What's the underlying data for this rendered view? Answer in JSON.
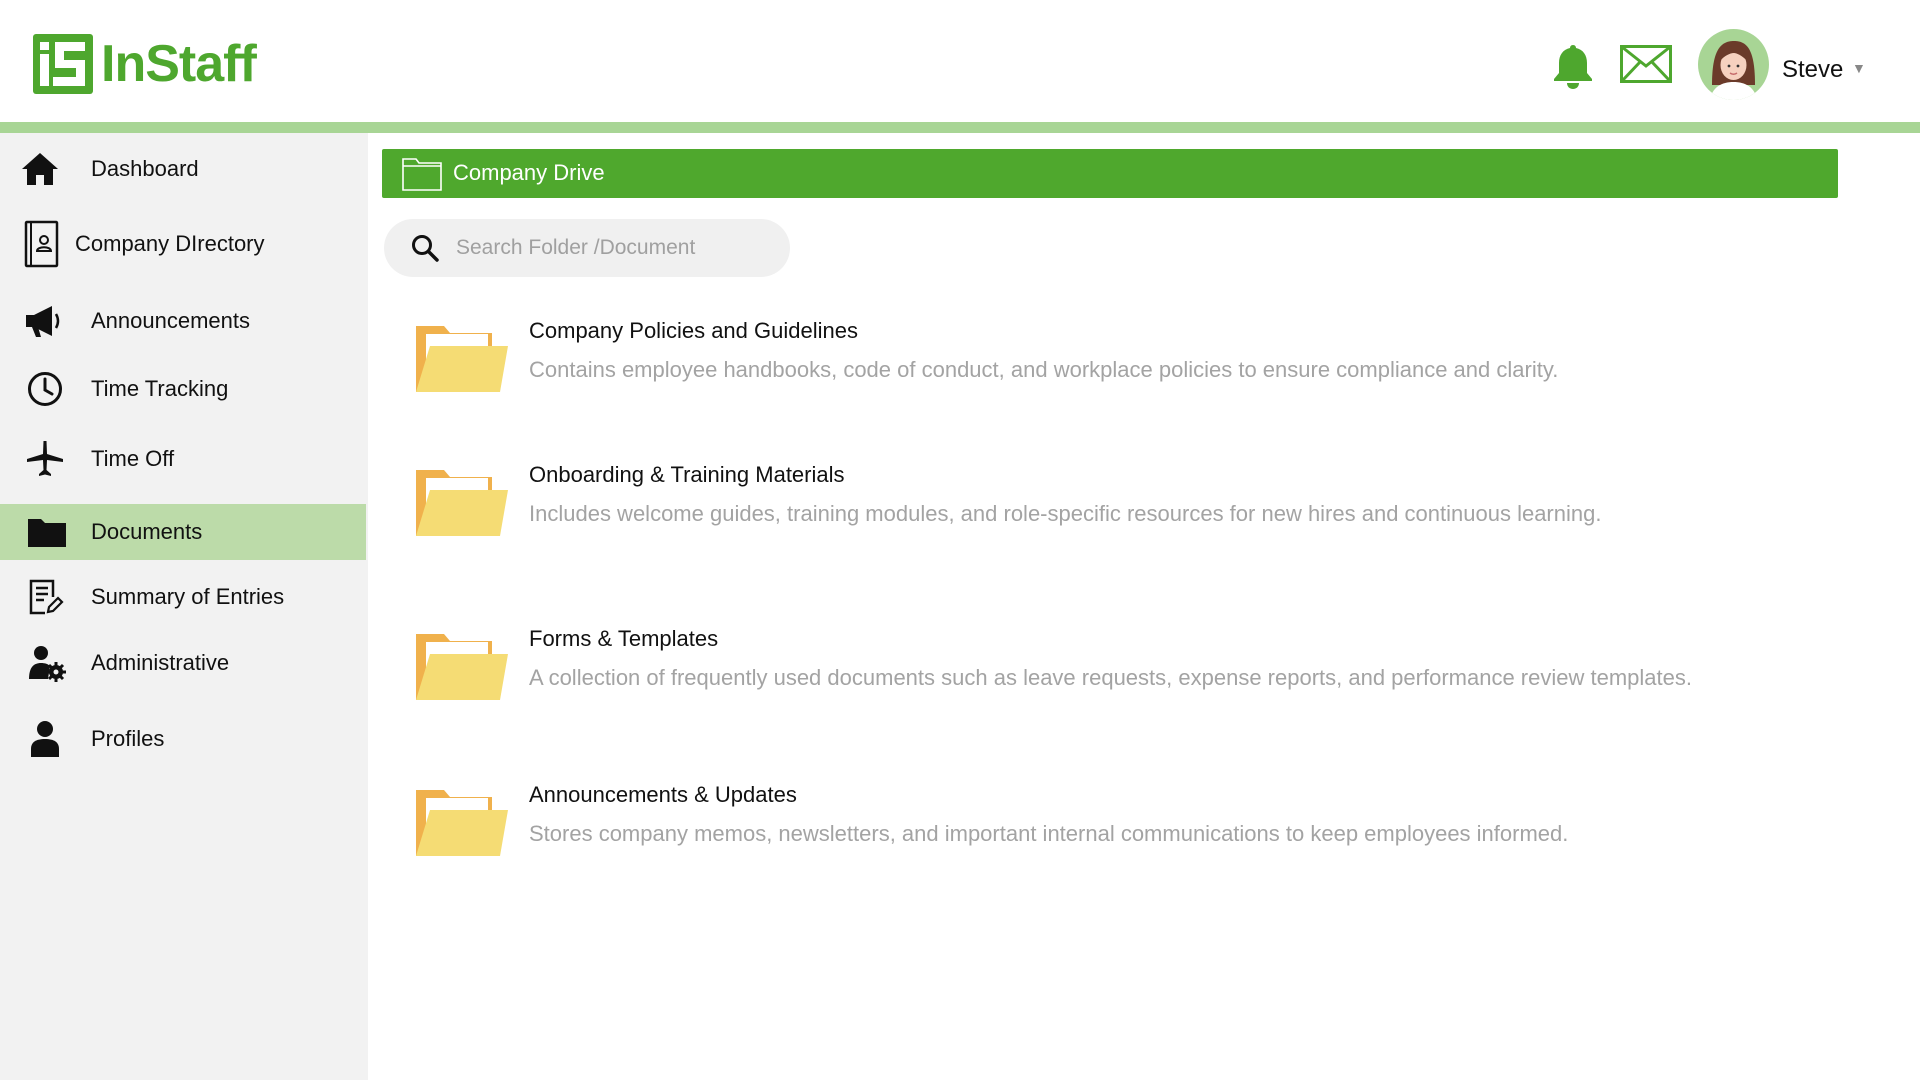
{
  "brand": {
    "name": "InStaff",
    "color": "#4ea72e"
  },
  "header": {
    "icons": [
      "bell-icon",
      "mail-icon"
    ],
    "user": {
      "name": "Steve",
      "caret": "▼"
    }
  },
  "sidebar": {
    "active_color": "#bcdba9",
    "items": [
      {
        "label": "Dashboard",
        "icon": "home-icon"
      },
      {
        "label": "Company DIrectory",
        "icon": "contact-book-icon"
      },
      {
        "label": "Announcements",
        "icon": "megaphone-icon"
      },
      {
        "label": "Time Tracking",
        "icon": "clock-icon"
      },
      {
        "label": "Time Off",
        "icon": "airplane-icon"
      },
      {
        "label": "Documents",
        "icon": "folder-icon",
        "active": true
      },
      {
        "label": "Summary of Entries",
        "icon": "edit-document-icon"
      },
      {
        "label": "Administrative",
        "icon": "user-gear-icon"
      },
      {
        "label": "Profiles",
        "icon": "user-icon"
      }
    ]
  },
  "drive": {
    "title": "Company Drive",
    "color": "#4fa82d"
  },
  "search": {
    "placeholder": "Search Folder /Document",
    "value": ""
  },
  "folders": [
    {
      "title": "Company Policies and Guidelines",
      "description": "Contains employee handbooks, code of conduct, and workplace policies to ensure compliance and clarity."
    },
    {
      "title": "Onboarding & Training Materials",
      "description": "Includes welcome guides, training modules, and role-specific resources for new hires and continuous learning."
    },
    {
      "title": "Forms & Templates",
      "description": "A collection of frequently used documents such as leave requests, expense reports, and performance review templates."
    },
    {
      "title": "Announcements & Updates",
      "description": "Stores company memos, newsletters, and important internal communications to keep employees informed."
    }
  ]
}
